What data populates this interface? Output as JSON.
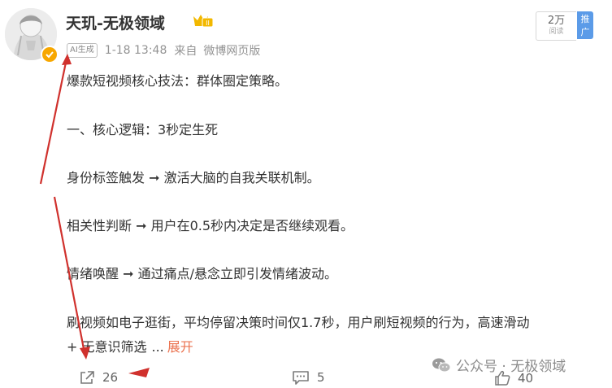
{
  "author": {
    "name": "天玑-无极领域",
    "vip_level": "II"
  },
  "meta": {
    "ai_tag": "AI生成",
    "time": "1-18 13:48",
    "source_prefix": "来自",
    "source": "微博网页版"
  },
  "follow": {
    "count": "2万",
    "label": "阅读"
  },
  "promo": "推广",
  "post": {
    "lines": [
      "爆款短视频核心技法：群体圈定策略。",
      "一、核心逻辑：3秒定生死",
      "身份标签触发 ➞ 激活大脑的自我关联机制。",
      "相关性判断 ➞ 用户在0.5秒内决定是否继续观看。",
      "情绪唤醒 ➞ 通过痛点/悬念立即引发情绪波动。",
      "刷视频如电子逛街，平均停留决策时间仅1.7秒，用户刷短视频的行为，高速滑动",
      "+ 无意识筛选"
    ],
    "ellipsis": "...",
    "expand_label": "展开"
  },
  "actions": {
    "share_count": "26",
    "comment_count": "5",
    "like_count": "40"
  },
  "watermark": "公众号 · 无极领域",
  "colors": {
    "link": "#eb7350",
    "annotation": "#d0312d",
    "promo": "#5b9be8",
    "vip": "#f2b800"
  }
}
